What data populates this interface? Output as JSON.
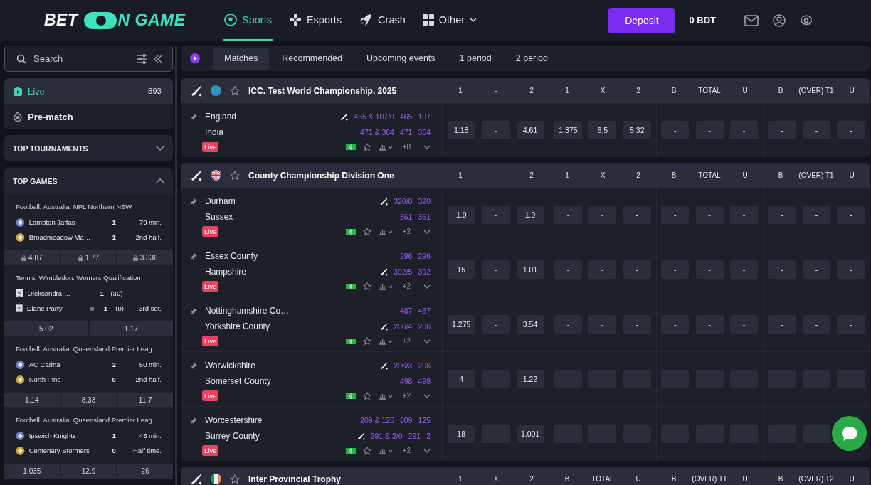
{
  "header": {
    "logo": {
      "left": "BET",
      "right": "N GAME"
    },
    "nav": [
      {
        "label": "Sports",
        "selected": true,
        "dropdown": false
      },
      {
        "label": "Esports",
        "selected": false,
        "dropdown": false
      },
      {
        "label": "Crash",
        "selected": false,
        "dropdown": false
      },
      {
        "label": "Other",
        "selected": false,
        "dropdown": true
      }
    ],
    "deposit": "Deposit",
    "balance": "0 BDT"
  },
  "sidebar": {
    "search": {
      "placeholder": "Search"
    },
    "modes": [
      {
        "label": "Live",
        "count": "893",
        "selected": true
      },
      {
        "label": "Pre-match",
        "selected": false
      }
    ],
    "sections": [
      {
        "title": "TOP TOURNAMENTS",
        "expanded": false
      },
      {
        "title": "TOP GAMES",
        "expanded": true
      }
    ],
    "games": [
      {
        "kind": "football",
        "league": "Football. Australia. NPL Northern NSW",
        "teams": [
          {
            "name": "Lambton Jaffas",
            "score": "1",
            "status": "79 min."
          },
          {
            "name": "Broadmeadow Ma…",
            "score": "1",
            "status": "2nd half."
          }
        ],
        "odds": [
          {
            "value": "4.87",
            "locked": true
          },
          {
            "value": "1.77",
            "locked": true
          },
          {
            "value": "3.336",
            "locked": true
          }
        ]
      },
      {
        "kind": "tennis",
        "league": "Tennis. Wimbledon. Women. Qualification",
        "teams": [
          {
            "name": "Oleksandra …",
            "score": "1",
            "points": "(30)",
            "serving": false
          },
          {
            "name": "Diane Parry",
            "score": "1",
            "points": "(0)",
            "status": "3rd set.",
            "serving": true
          }
        ],
        "odds": [
          {
            "value": "5.02",
            "locked": false
          },
          {
            "value": "1.17",
            "locked": false
          }
        ]
      },
      {
        "kind": "football",
        "league": "Football. Australia. Queensland Premier Leag…",
        "teams": [
          {
            "name": "AC Carina",
            "score": "2",
            "status": "50 min."
          },
          {
            "name": "North Pine",
            "score": "0",
            "status": "2nd half."
          }
        ],
        "odds": [
          {
            "value": "1.14",
            "locked": false
          },
          {
            "value": "8.33",
            "locked": false
          },
          {
            "value": "11.7",
            "locked": false
          }
        ]
      },
      {
        "kind": "football",
        "league": "Football. Australia. Queensland Premier Leag…",
        "teams": [
          {
            "name": "Ipswich Knights",
            "score": "1",
            "status": "45 min."
          },
          {
            "name": "Centenary Stormers",
            "score": "0",
            "status": "Half time."
          }
        ],
        "odds": [
          {
            "value": "1.035",
            "locked": false
          },
          {
            "value": "12.9",
            "locked": false
          },
          {
            "value": "26",
            "locked": false
          }
        ]
      }
    ]
  },
  "tabs": [
    {
      "label": "Matches",
      "selected": true
    },
    {
      "label": "Recommended",
      "selected": false
    },
    {
      "label": "Upcoming events",
      "selected": false
    },
    {
      "label": "1 period",
      "selected": false
    },
    {
      "label": "2 period",
      "selected": false
    }
  ],
  "leagues": [
    {
      "name": "ICC. Test World Championship. 2025",
      "kind": "globe",
      "columns": [
        "1",
        "-",
        "2",
        "1",
        "X",
        "2",
        "B",
        "TOTAL",
        "U",
        "B",
        "(OVER) T1",
        "U"
      ],
      "matches": [
        {
          "teams": [
            {
              "name": "England",
              "batting": true,
              "scores": [
                "465 & 107/0",
                "465",
                "107"
              ]
            },
            {
              "name": "India",
              "batting": false,
              "scores": [
                "471 & 364",
                "471",
                "364"
              ]
            }
          ],
          "badge": "Live",
          "more": "+8",
          "odds": [
            "1.18",
            "-",
            "4.61",
            "1.375",
            "6.5",
            "5.32",
            "-",
            "-",
            "-",
            "-",
            "-",
            "-"
          ]
        }
      ]
    },
    {
      "name": "County Championship Division One",
      "kind": "uk",
      "columns": [
        "1",
        "-",
        "2",
        "1",
        "X",
        "2",
        "B",
        "TOTAL",
        "U",
        "B",
        "(OVER) T1",
        "U"
      ],
      "matches": [
        {
          "teams": [
            {
              "name": "Durham",
              "batting": true,
              "scores": [
                "320/8",
                "320"
              ]
            },
            {
              "name": "Sussex",
              "batting": false,
              "scores": [
                "361",
                "361"
              ]
            }
          ],
          "badge": "Live",
          "more": "+2",
          "odds": [
            "1.9",
            "-",
            "1.9",
            "-",
            "-",
            "-",
            "-",
            "-",
            "-",
            "-",
            "-",
            "-"
          ]
        },
        {
          "teams": [
            {
              "name": "Essex County",
              "batting": false,
              "scores": [
                "296",
                "296"
              ]
            },
            {
              "name": "Hampshire",
              "batting": true,
              "scores": [
                "392/5",
                "392"
              ]
            }
          ],
          "badge": "Live",
          "more": "+2",
          "odds": [
            "15",
            "-",
            "1.01",
            "-",
            "-",
            "-",
            "-",
            "-",
            "-",
            "-",
            "-",
            "-"
          ]
        },
        {
          "teams": [
            {
              "name": "Nottinghamshire Co…",
              "batting": false,
              "scores": [
                "487",
                "487"
              ]
            },
            {
              "name": "Yorkshire County",
              "batting": true,
              "scores": [
                "206/4",
                "206"
              ]
            }
          ],
          "badge": "Live",
          "more": "+2",
          "odds": [
            "1.275",
            "-",
            "3.54",
            "-",
            "-",
            "-",
            "-",
            "-",
            "-",
            "-",
            "-",
            "-"
          ]
        },
        {
          "teams": [
            {
              "name": "Warwickshire",
              "batting": true,
              "scores": [
                "206/3",
                "206"
              ]
            },
            {
              "name": "Somerset County",
              "batting": false,
              "scores": [
                "498",
                "498"
              ]
            }
          ],
          "badge": "Live",
          "more": "+2",
          "odds": [
            "4",
            "-",
            "1.22",
            "-",
            "-",
            "-",
            "-",
            "-",
            "-",
            "-",
            "-",
            "-"
          ]
        },
        {
          "teams": [
            {
              "name": "Worcestershire",
              "batting": false,
              "scores": [
                "209 & 125",
                "209",
                "125"
              ]
            },
            {
              "name": "Surrey County",
              "batting": true,
              "scores": [
                "291 & 2/0",
                "291",
                "2"
              ]
            }
          ],
          "badge": "Live",
          "more": "+2",
          "odds": [
            "18",
            "-",
            "1.001",
            "-",
            "-",
            "-",
            "-",
            "-",
            "-",
            "-",
            "-"
          ]
        }
      ]
    },
    {
      "name": "Inter Provincial Trophy",
      "kind": "ireland",
      "columns": [
        "1",
        "X",
        "2",
        "B",
        "TOTAL",
        "U",
        "B",
        "(OVER) T1",
        "U",
        "B",
        "(OVER) T2",
        "U"
      ]
    }
  ]
}
